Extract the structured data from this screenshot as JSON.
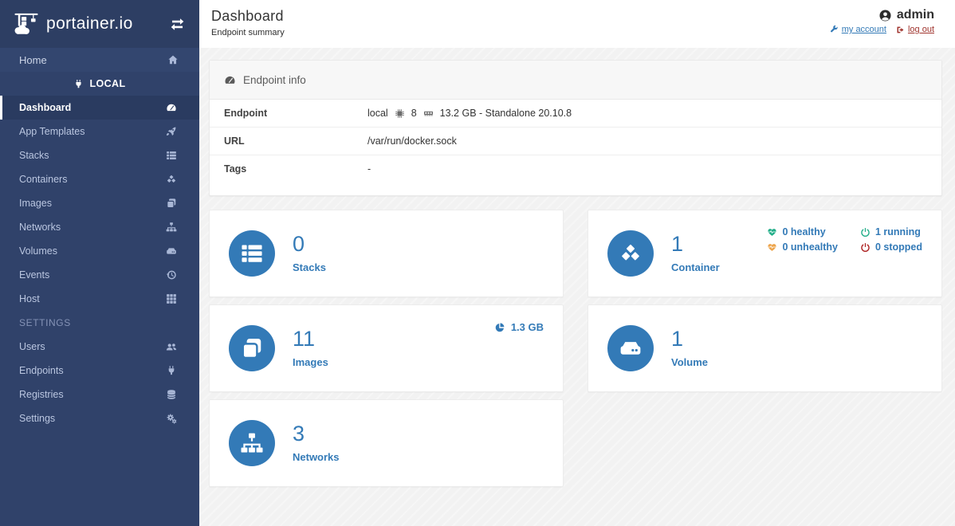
{
  "colors": {
    "sidebar_bg": "#30426a",
    "sidebar_header_bg": "#2d3e63",
    "accent_blue": "#337ab7",
    "healthy_green": "#23ae89",
    "unhealthy_orange": "#eda54d",
    "stopped_red": "#ae2323",
    "logout_red": "#a0342e",
    "content_bg": "#f2f2f2"
  },
  "sidebar": {
    "logo_text": "portainer.io",
    "logo_icon": "portainer-logo",
    "toggle_icon": "exchange",
    "home": {
      "label": "Home",
      "icon": "home"
    },
    "endpoint_switch": {
      "label": "LOCAL",
      "icon": "plug"
    },
    "items": [
      {
        "label": "Dashboard",
        "icon": "tachometer",
        "active": true
      },
      {
        "label": "App Templates",
        "icon": "rocket",
        "active": false
      },
      {
        "label": "Stacks",
        "icon": "th-list",
        "active": false
      },
      {
        "label": "Containers",
        "icon": "cubes",
        "active": false
      },
      {
        "label": "Images",
        "icon": "clone",
        "active": false
      },
      {
        "label": "Networks",
        "icon": "sitemap",
        "active": false
      },
      {
        "label": "Volumes",
        "icon": "hdd",
        "active": false
      },
      {
        "label": "Events",
        "icon": "history",
        "active": false
      },
      {
        "label": "Host",
        "icon": "th",
        "active": false
      }
    ],
    "settings_title": "SETTINGS",
    "settings_items": [
      {
        "label": "Users",
        "icon": "users",
        "active": false
      },
      {
        "label": "Endpoints",
        "icon": "plug",
        "active": false
      },
      {
        "label": "Registries",
        "icon": "database",
        "active": false
      },
      {
        "label": "Settings",
        "icon": "cogs",
        "active": false
      }
    ]
  },
  "header": {
    "title": "Dashboard",
    "subtitle": "Endpoint summary",
    "user": {
      "name": "admin",
      "icon": "user-circle"
    },
    "links": [
      {
        "label": "my account",
        "icon": "wrench",
        "color": "#337ab7"
      },
      {
        "label": "log out",
        "icon": "sign-out",
        "color": "#a0342e"
      }
    ]
  },
  "endpoint_info": {
    "icon": "tachometer",
    "title": "Endpoint info",
    "rows": [
      {
        "label": "Endpoint",
        "parts": [
          {
            "text": "local"
          },
          {
            "icon": "microchip"
          },
          {
            "text": "8"
          },
          {
            "icon": "memory"
          },
          {
            "text": "13.2 GB - Standalone 20.10.8"
          }
        ]
      },
      {
        "label": "URL",
        "parts": [
          {
            "text": "/var/run/docker.sock"
          }
        ]
      },
      {
        "label": "Tags",
        "parts": [
          {
            "text": "-"
          }
        ]
      }
    ]
  },
  "cards": [
    {
      "id": "stacks",
      "icon": "th-list",
      "count": "0",
      "label": "Stacks"
    },
    {
      "id": "containers",
      "icon": "cubes",
      "count": "1",
      "label": "Container",
      "statuses": [
        {
          "icon": "heartbeat",
          "color": "#23ae89",
          "text": "0 healthy"
        },
        {
          "icon": "power",
          "color": "#23ae89",
          "text": "1 running"
        },
        {
          "icon": "heartbeat",
          "color": "#eda54d",
          "text": "0 unhealthy"
        },
        {
          "icon": "power",
          "color": "#ae2323",
          "text": "0 stopped"
        }
      ]
    },
    {
      "id": "images",
      "icon": "clone",
      "count": "11",
      "label": "Images",
      "extra": {
        "icon": "pie-chart",
        "text": "1.3 GB"
      }
    },
    {
      "id": "volumes",
      "icon": "hdd",
      "count": "1",
      "label": "Volume"
    },
    {
      "id": "networks",
      "icon": "sitemap",
      "count": "3",
      "label": "Networks"
    }
  ]
}
